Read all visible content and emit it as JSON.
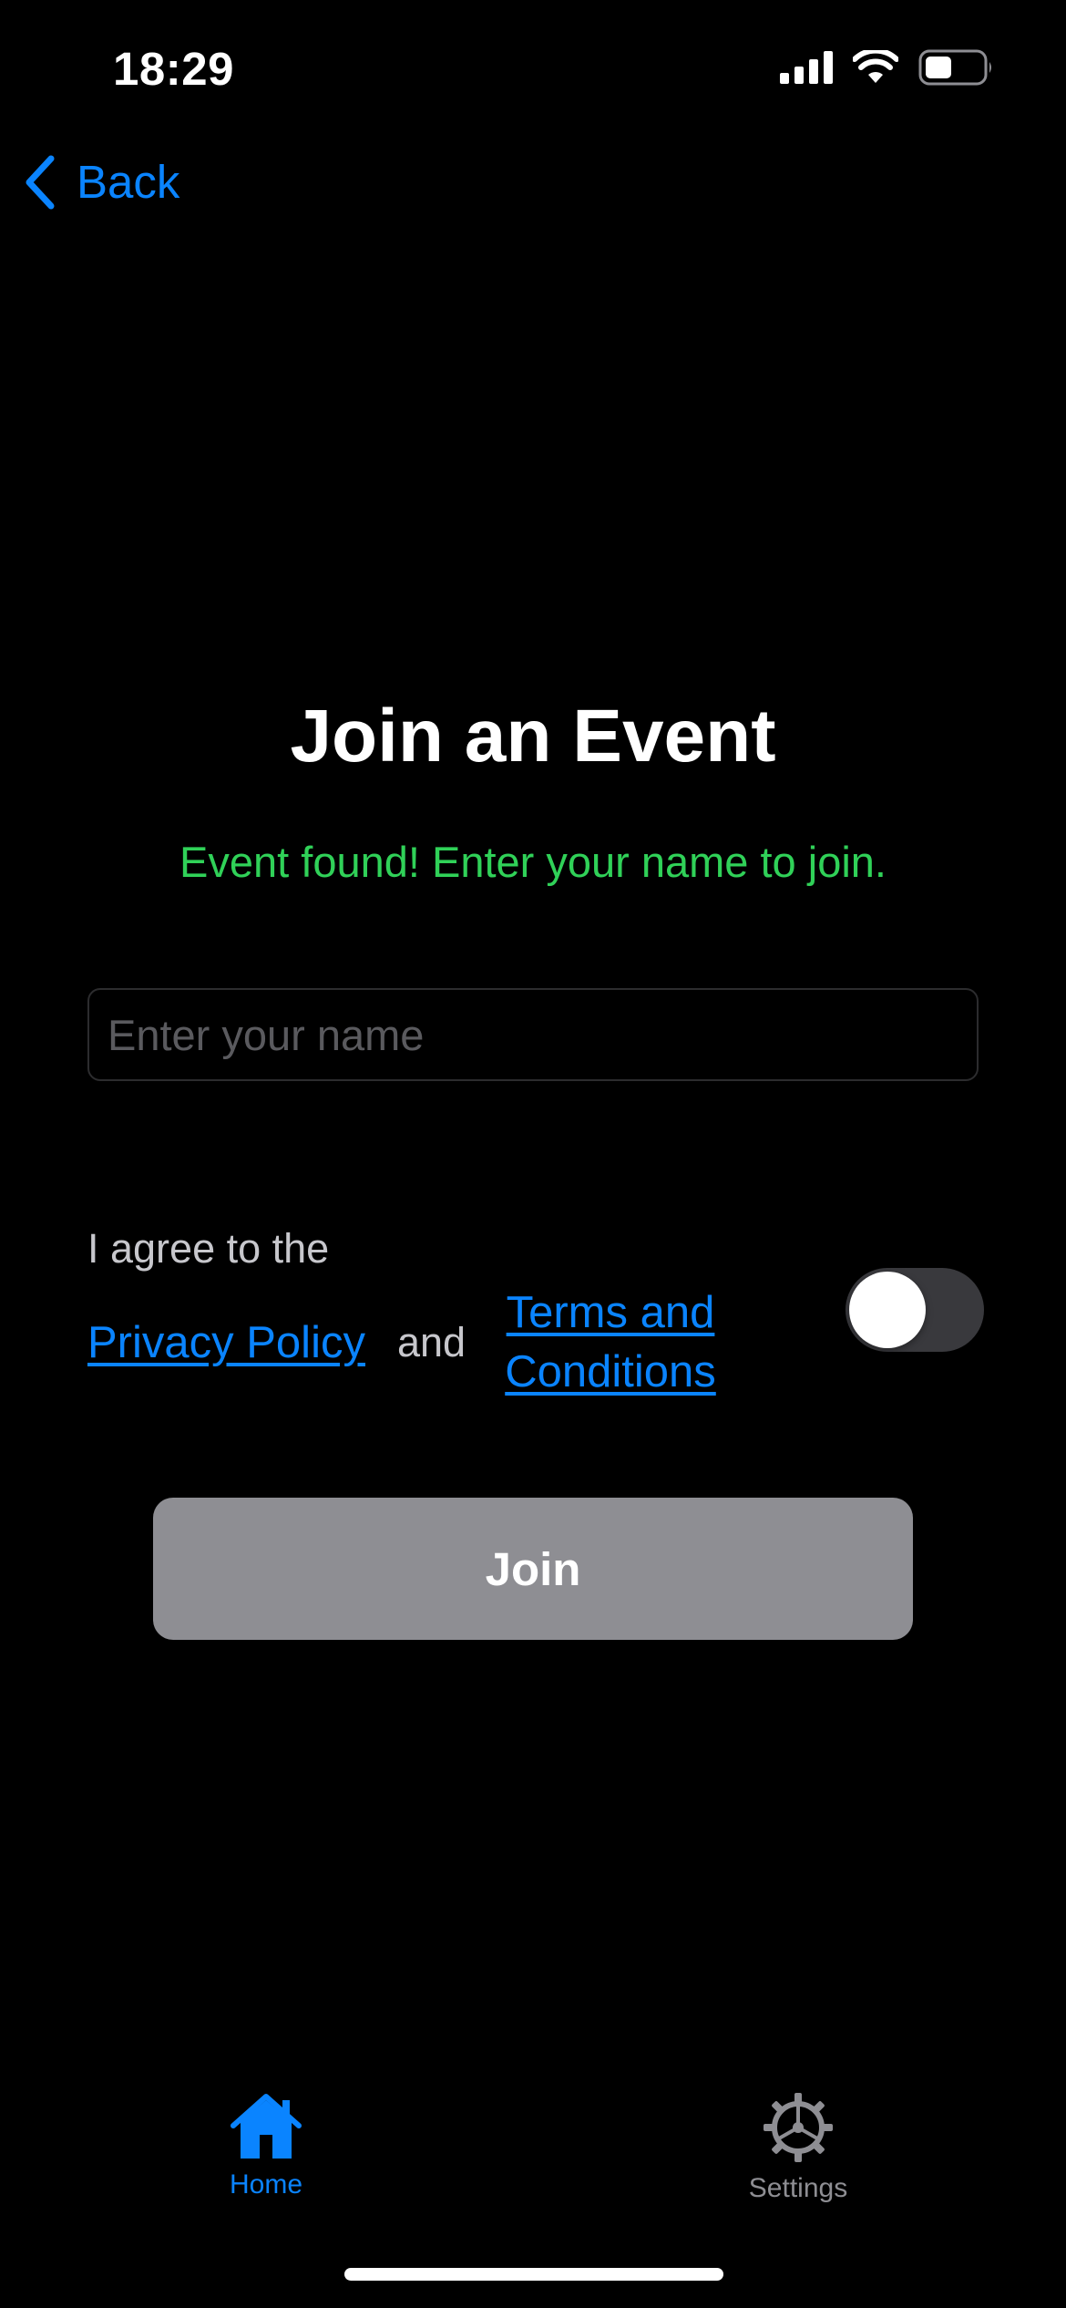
{
  "status_bar": {
    "time": "18:29"
  },
  "nav": {
    "back_label": "Back"
  },
  "main": {
    "title": "Join an Event",
    "status_message": "Event found! Enter your name to join.",
    "name_input": {
      "value": "",
      "placeholder": "Enter your name"
    },
    "agreement": {
      "prefix": "I agree to the",
      "privacy_link": "Privacy Policy",
      "conjunction": "and",
      "terms_link": "Terms and Conditions",
      "toggle_on": false
    },
    "join_label": "Join"
  },
  "tab_bar": {
    "items": [
      {
        "label": "Home",
        "icon": "house-icon",
        "active": true
      },
      {
        "label": "Settings",
        "icon": "gear-icon",
        "active": false
      }
    ]
  },
  "colors": {
    "accent": "#0A84FF",
    "success": "#30D158",
    "background": "#000000",
    "disabled_button": "#8E8E93"
  }
}
